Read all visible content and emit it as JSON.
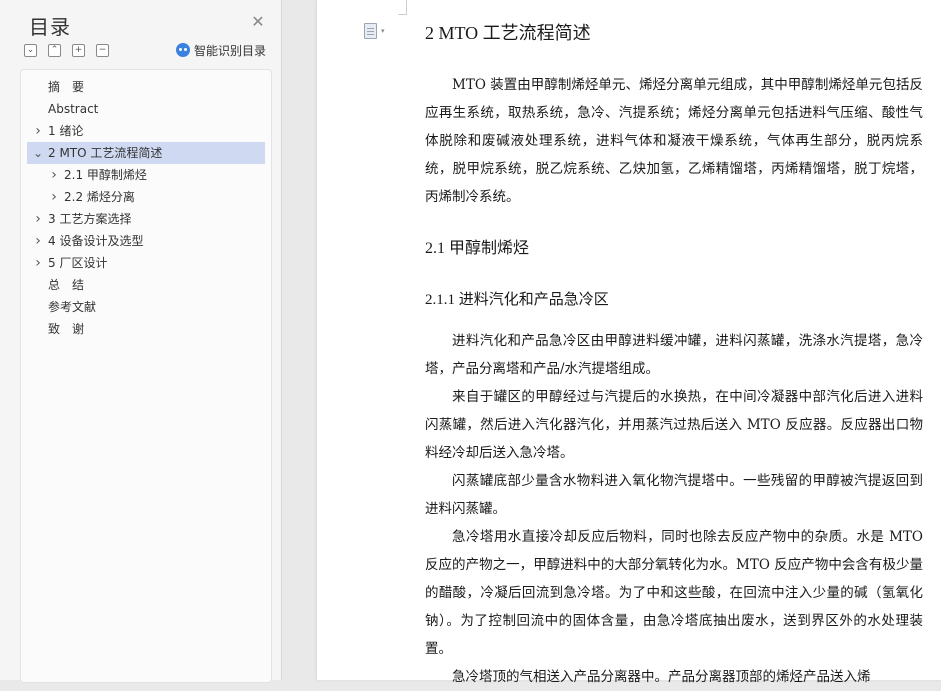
{
  "toc": {
    "title": "目录",
    "close_icon": "close-icon",
    "tools": [
      "collapse-icon",
      "expand-icon",
      "add-icon",
      "remove-icon"
    ],
    "smart_label": "智能识别目录",
    "items": [
      {
        "label": "摘　要",
        "level": 1,
        "has_children": false,
        "selected": false
      },
      {
        "label": "Abstract",
        "level": 1,
        "has_children": false,
        "selected": false
      },
      {
        "label": "1 绪论",
        "level": 1,
        "has_children": true,
        "expanded": false,
        "selected": false
      },
      {
        "label": "2 MTO 工艺流程简述",
        "level": 1,
        "has_children": true,
        "expanded": true,
        "selected": true
      },
      {
        "label": "2.1 甲醇制烯烃",
        "level": 2,
        "has_children": true,
        "expanded": false,
        "selected": false
      },
      {
        "label": "2.2 烯烃分离",
        "level": 2,
        "has_children": true,
        "expanded": false,
        "selected": false
      },
      {
        "label": "3 工艺方案选择",
        "level": 1,
        "has_children": true,
        "expanded": false,
        "selected": false
      },
      {
        "label": "4 设备设计及选型",
        "level": 1,
        "has_children": true,
        "expanded": false,
        "selected": false
      },
      {
        "label": "5 厂区设计",
        "level": 1,
        "has_children": true,
        "expanded": false,
        "selected": false
      },
      {
        "label": "总　结",
        "level": 1,
        "has_children": false,
        "selected": false
      },
      {
        "label": "参考文献",
        "level": 1,
        "has_children": false,
        "selected": false
      },
      {
        "label": "致　谢",
        "level": 1,
        "has_children": false,
        "selected": false
      }
    ]
  },
  "doc": {
    "heading_2": "2 MTO 工艺流程简述",
    "heading_2_1": "2.1 甲醇制烯烃",
    "heading_2_1_1": "2.1.1 进料汽化和产品急冷区",
    "paragraphs": [
      "MTO 装置由甲醇制烯烃单元、烯烃分离单元组成，其中甲醇制烯烃单元包括反应再生系统，取热系统，急冷、汽提系统；烯烃分离单元包括进料气压缩、酸性气体脱除和废碱液处理系统，进料气体和凝液干燥系统，气体再生部分，脱丙烷系统，脱甲烷系统，脱乙烷系统、乙炔加氢，乙烯精馏塔，丙烯精馏塔，脱丁烷塔，丙烯制冷系统。",
      "进料汽化和产品急冷区由甲醇进料缓冲罐，进料闪蒸罐，洗涤水汽提塔，急冷塔，产品分离塔和产品/水汽提塔组成。",
      "来自于罐区的甲醇经过与汽提后的水换热，在中间冷凝器中部汽化后进入进料闪蒸罐，然后进入汽化器汽化，并用蒸汽过热后送入 MTO 反应器。反应器出口物料经冷却后送入急冷塔。",
      "闪蒸罐底部少量含水物料进入氧化物汽提塔中。一些残留的甲醇被汽提返回到进料闪蒸罐。",
      "急冷塔用水直接冷却反应后物料，同时也除去反应产物中的杂质。水是 MTO 反应的产物之一，甲醇进料中的大部分氧转化为水。MTO 反应产物中会含有极少量的醋酸，冷凝后回流到急冷塔。为了中和这些酸，在回流中注入少量的碱（氢氧化钠）。为了控制回流中的固体含量，由急冷塔底抽出废水，送到界区外的水处理装置。",
      "急冷塔顶的气相送入产品分离器中。产品分离器顶部的烯烃产品送入烯"
    ]
  },
  "nav_icon": "document-nav-icon"
}
